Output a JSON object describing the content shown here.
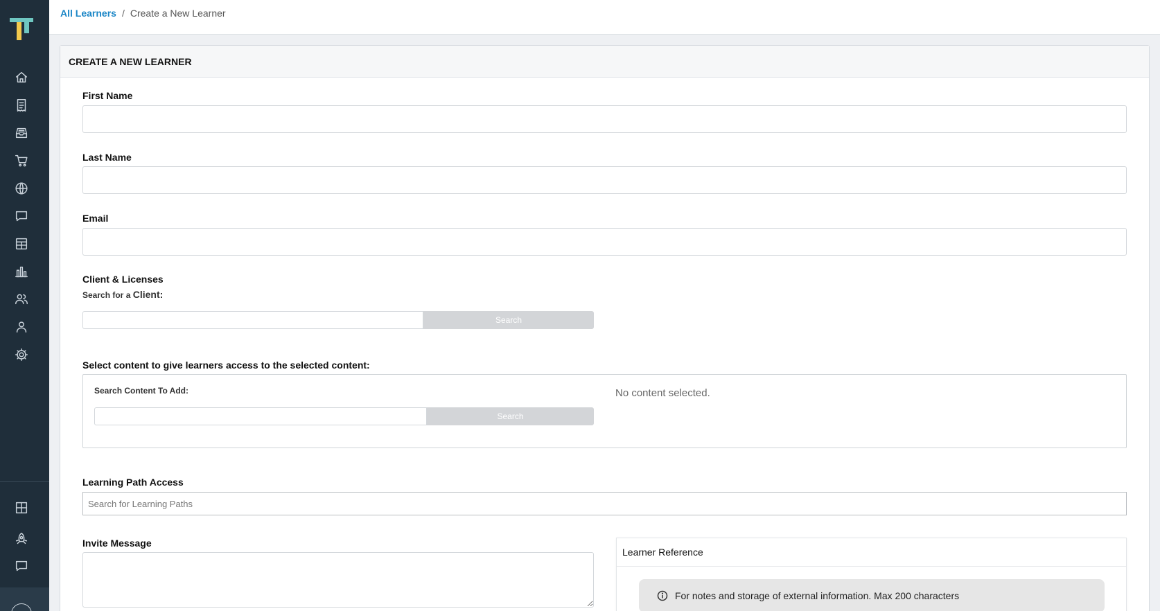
{
  "breadcrumb": {
    "parent": "All Learners",
    "separator": "/",
    "current": "Create a New Learner"
  },
  "form": {
    "title": "CREATE A NEW LEARNER",
    "first_name": {
      "label": "First Name",
      "value": ""
    },
    "last_name": {
      "label": "Last Name",
      "value": ""
    },
    "email": {
      "label": "Email",
      "value": ""
    },
    "client": {
      "label": "Client & Licenses",
      "search_prefix": "Search for a",
      "search_target": "Client:",
      "value": "",
      "button": "Search"
    },
    "content": {
      "label": "Select content to give learners access to the selected content:",
      "search_label": "Search Content To Add:",
      "value": "",
      "button": "Search",
      "empty_text": "No content selected."
    },
    "learning_path": {
      "label": "Learning Path Access",
      "placeholder": "Search for Learning Paths"
    },
    "invite_message": {
      "label": "Invite Message",
      "value": ""
    },
    "learner_reference": {
      "title": "Learner Reference",
      "info": "For notes and storage of external information. Max 200 characters"
    }
  },
  "sidebar": {
    "items": [
      "home-icon",
      "receipt-icon",
      "inbox-icon",
      "cart-icon",
      "globe-icon",
      "chat-icon",
      "table-icon",
      "bar-chart-icon",
      "users-icon",
      "user-icon",
      "gear-icon"
    ],
    "bottom_items": [
      "grid-icon",
      "rocket-icon",
      "chat-icon"
    ],
    "colors": {
      "background": "#1f2e3a",
      "icon": "#c9d2da"
    }
  },
  "colors": {
    "link": "#1b86c6",
    "logo_teal": "#6fc7c1",
    "logo_yellow": "#f2c94c"
  }
}
